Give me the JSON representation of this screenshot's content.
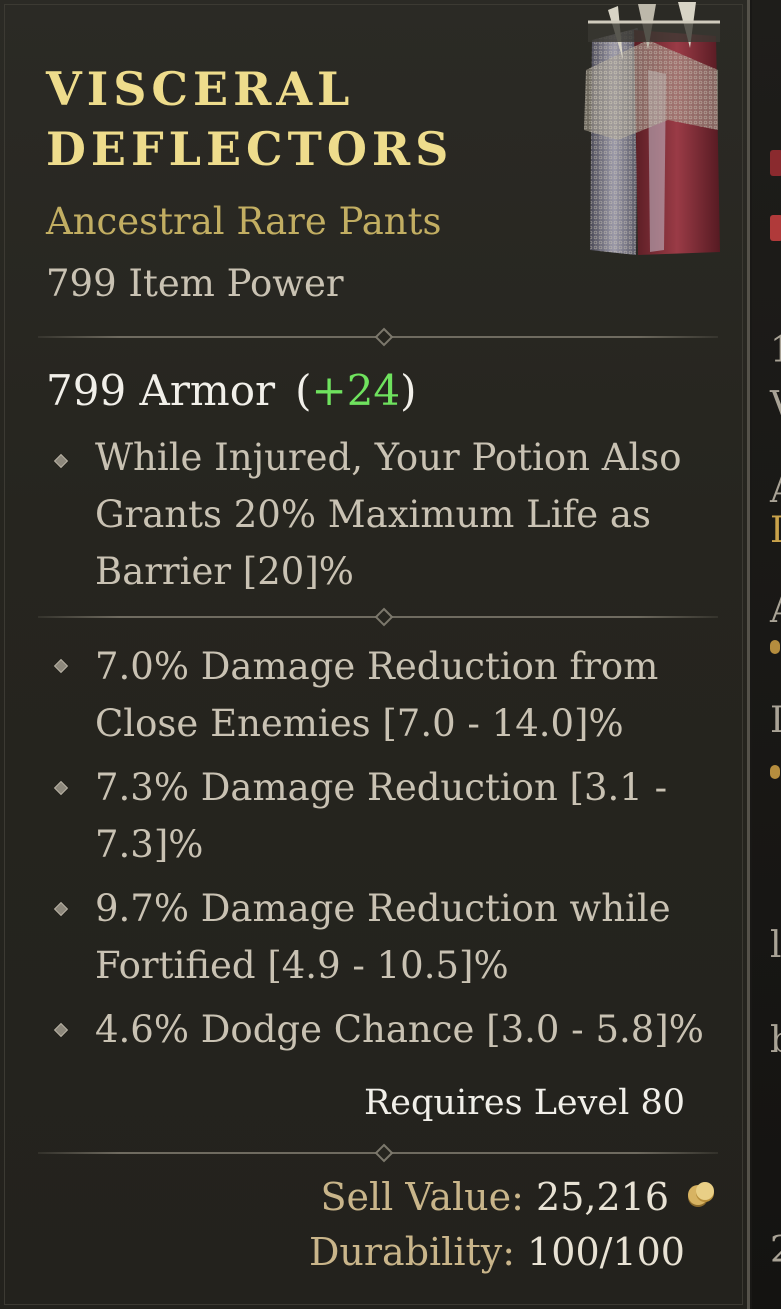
{
  "item": {
    "name_line1": "VISCERAL",
    "name_line2": "DEFLECTORS",
    "type": "Ancestral Rare Pants",
    "item_power": "799 Item Power",
    "armor_value": "799 Armor",
    "armor_bonus": "+24",
    "implicit": "While Injured, Your Potion Also Grants 20% Maximum Life as Barrier [20]%",
    "affixes": [
      "7.0% Damage Reduction from Close Enemies [7.0 - 14.0]%",
      "7.3% Damage Reduction [3.1 - 7.3]%",
      "9.7% Damage Reduction while Fortified [4.9 - 10.5]%",
      "4.6% Dodge Chance [3.0 - 5.8]%"
    ],
    "requires": "Requires Level 80",
    "sell_label": "Sell Value:",
    "sell_value": "25,216",
    "durability_label": "Durability:",
    "durability_value": "100/100"
  },
  "icons": {
    "item_image": "pants-item-icon",
    "coin": "gold-coin-icon",
    "bullet": "diamond-bullet-icon"
  },
  "colors": {
    "title": "#eedc8c",
    "rarity": "#c2ae62",
    "bonus": "#6fe25e",
    "background": "#26251f"
  }
}
